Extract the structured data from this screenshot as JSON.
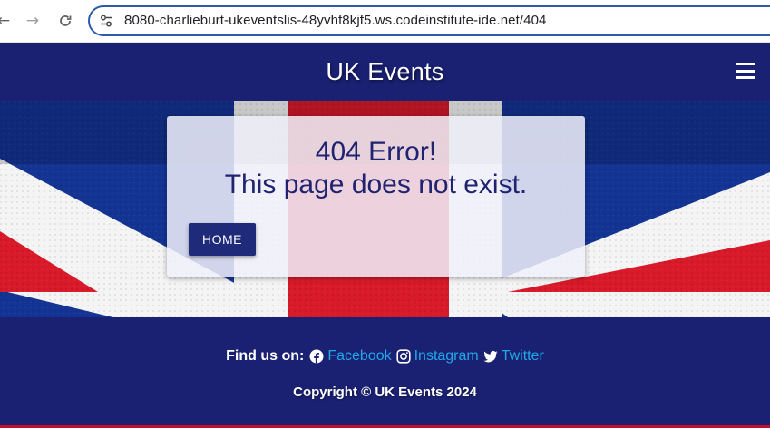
{
  "browser": {
    "url": "8080-charlieburt-ukeventslis-48yvhf8kjf5.ws.codeinstitute-ide.net/404",
    "back_icon": "arrow-left-icon",
    "forward_icon": "arrow-right-icon",
    "reload_icon": "reload-icon",
    "site_info_icon": "tune-icon"
  },
  "header": {
    "title": "UK Events",
    "menu_icon": "hamburger-menu-icon",
    "background": "#1a2173"
  },
  "hero": {
    "background_image": "union-jack-flag",
    "error_title": "404 Error!",
    "error_message": "This page does not exist.",
    "home_button_label": "HOME"
  },
  "footer": {
    "find_us_label": "Find us on:",
    "links": [
      {
        "label": "Facebook",
        "icon": "facebook-icon"
      },
      {
        "label": "Instagram",
        "icon": "instagram-icon"
      },
      {
        "label": "Twitter",
        "icon": "twitter-icon"
      }
    ],
    "copyright": "Copyright © UK Events 2024",
    "link_color": "#20a8e6",
    "accent": "#c0122a"
  }
}
